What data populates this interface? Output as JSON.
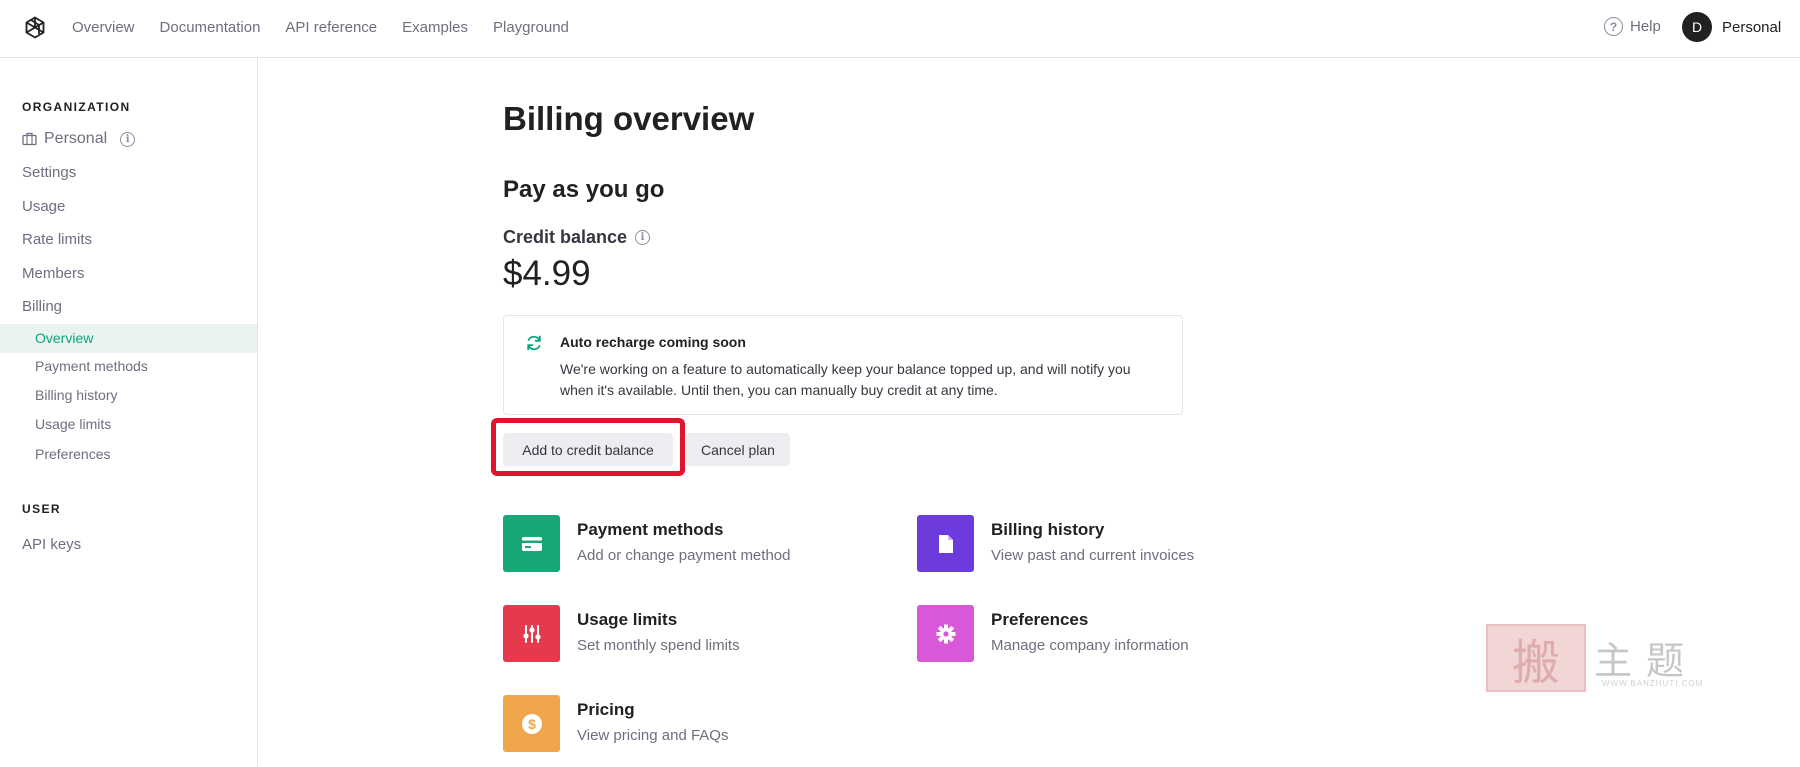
{
  "topbar": {
    "logo_icon": "openai-logo-icon",
    "nav": [
      "Overview",
      "Documentation",
      "API reference",
      "Examples",
      "Playground"
    ],
    "help_label": "Help",
    "avatar_initial": "D",
    "account_label": "Personal"
  },
  "sidebar": {
    "org_section": "ORGANIZATION",
    "org_name": "Personal",
    "items": [
      "Settings",
      "Usage",
      "Rate limits",
      "Members",
      "Billing"
    ],
    "billing_sub": [
      "Overview",
      "Payment methods",
      "Billing history",
      "Usage limits",
      "Preferences"
    ],
    "active_sub": "Overview",
    "user_section": "USER",
    "user_items": [
      "API keys"
    ]
  },
  "main": {
    "title": "Billing overview",
    "plan_title": "Pay as you go",
    "balance_label": "Credit balance",
    "balance_value": "$4.99",
    "notice": {
      "title": "Auto recharge coming soon",
      "body": "We're working on a feature to automatically keep your balance topped up, and will notify you when it's available. Until then, you can manually buy credit at any time."
    },
    "buttons": {
      "add_credit": "Add to credit balance",
      "cancel_plan": "Cancel plan"
    },
    "cards": [
      {
        "title": "Payment methods",
        "subtitle": "Add or change payment method",
        "icon": "credit-card-icon",
        "color": "#19a77a"
      },
      {
        "title": "Billing history",
        "subtitle": "View past and current invoices",
        "icon": "document-icon",
        "color": "#6d3bdc"
      },
      {
        "title": "Usage limits",
        "subtitle": "Set monthly spend limits",
        "icon": "sliders-icon",
        "color": "#e5394d"
      },
      {
        "title": "Preferences",
        "subtitle": "Manage company information",
        "icon": "gear-icon",
        "color": "#d957d9"
      },
      {
        "title": "Pricing",
        "subtitle": "View pricing and FAQs",
        "icon": "dollar-icon",
        "color": "#f0a64a"
      }
    ]
  },
  "watermark": {
    "seal_char": "搬",
    "text": "主题",
    "url": "WWW.BANZHUTI.COM"
  },
  "colors": {
    "accent": "#10a37f",
    "highlight": "#e0142c",
    "active_bg": "#e9f4f1"
  }
}
